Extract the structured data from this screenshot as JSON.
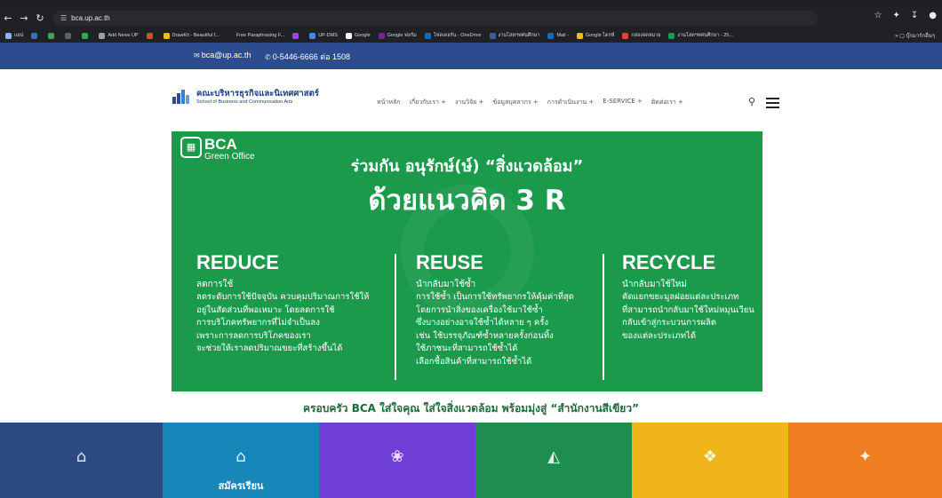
{
  "browser": {
    "url": "bca.up.ac.th",
    "bookmarks": [
      {
        "label": "แอป",
        "color": "#8ab4f8"
      },
      {
        "label": "",
        "color": "#1a73e8"
      },
      {
        "label": "",
        "color": "#34a853"
      },
      {
        "label": "",
        "color": "#5f6368"
      },
      {
        "label": "",
        "color": "#34a853"
      },
      {
        "label": "Add News UP",
        "color": "#9aa0a6"
      },
      {
        "label": "",
        "color": "#ea4335"
      },
      {
        "label": "DrawKit - Beautiful f...",
        "color": "#fbbc04"
      },
      {
        "label": "Free Paraphrasing F...",
        "color": "#202124"
      },
      {
        "label": "",
        "color": "#a142f4"
      },
      {
        "label": "UP-DMS",
        "color": "#4285f4"
      },
      {
        "label": "Google",
        "color": "#ffffff"
      },
      {
        "label": "Google ฟอร์ม",
        "color": "#7b1fa2"
      },
      {
        "label": "โฟลเดอร์น - OneDrive",
        "color": "#0f6cbd"
      },
      {
        "label": "งานโสตฯทศนศึกษา",
        "color": "#3b5ba9"
      },
      {
        "label": "Mail -",
        "color": "#0f6cbd"
      },
      {
        "label": "Google ไดรฟ์",
        "color": "#fbbc04"
      },
      {
        "label": "กล่องจดหมาย",
        "color": "#ea4335"
      },
      {
        "label": "งานโสตฯทศนศึกษา - 25...",
        "color": "#0f9d58"
      }
    ],
    "bookmarks_right": "บุ๊กมาร์กอื่นๆ"
  },
  "contact": {
    "email": "bca@up.ac.th",
    "phone": "0-5446-6666 ต่อ 1508"
  },
  "header": {
    "logo_title": "คณะบริหารธุรกิจและนิเทศศาสตร์",
    "logo_subtitle": "School of Business and Communication Arts",
    "nav": [
      "หน้าหลัก",
      "เกี่ยวกับเรา +",
      "งานวิจัย +",
      "ข้อมูลบุคลากร +",
      "การดำเนินงาน +",
      "E-SERVICE +",
      "ติดต่อเรา +"
    ]
  },
  "banner": {
    "brand": "BCA",
    "brand_sub": "Green Office",
    "headline1": "ร่วมกัน อนุรักษ์(ษ์) “สิ่งแวดล้อม”",
    "headline2": "ด้วยแนวคิด 3 R",
    "reduce": {
      "title": "REDUCE",
      "subtitle": "ลดการใช้",
      "body": "ลดระดับการใช้ปัจจุบัน ควบคุมปริมาณการใช้ให้\nอยู่ในสัดส่วนที่พอเหมาะ โดยลดการใช้\nการบริโภคทรัพยากรที่ไม่จำเป็นลง\nเพราะการลดการบริโภคของเรา\nจะช่วยให้เราลดปริมาณขยะที่สร้างขึ้นได้"
    },
    "reuse": {
      "title": "REUSE",
      "subtitle": "นำกลับมาใช้ซ้ำ",
      "body": "การใช้ซ้ำ เป็นการใช้ทรัพยากรให้คุ้มค่าที่สุด\nโดยการนำสิ่งของเครื่องใช้มาใช้ซ้ำ\nซึ่งบางอย่างอาจใช้ซ้ำได้หลาย ๆ ครั้ง\nเช่น ใช้บรรจุภัณฑ์ซ้ำหลายครั้งก่อนทิ้ง\nใช้ภาชนะที่สามารถใช้ซ้ำได้\nเลือกซื้อสินค้าที่สามารถใช้ซ้ำได้"
    },
    "recycle": {
      "title": "RECYCLE",
      "subtitle": "นำกลับมาใช้ใหม่",
      "body": "คัดแยกขยะมูลฝอยแต่ละประเภท\nที่สามารถนำกลับมาใช้ใหม่หมุนเวียน\nกลับเข้าสู่กระบวนการผลิต\nของแต่ละประเภทได้"
    },
    "colors": {
      "green": "#1b9a4c"
    }
  },
  "tagline": "ครอบครัว BCA ใส่ใจคุณ ใส่ใจสิ่งแวดล้อม พร้อมมุ่งสู่ “สำนักงานสีเขียว”",
  "tiles": [
    {
      "icon": "building-icon",
      "label": "",
      "color": "#2e4a82"
    },
    {
      "icon": "graduation-cap-icon",
      "label": "สมัครเรียน",
      "color": "#1687b8"
    },
    {
      "icon": "globe-people-icon",
      "label": "",
      "color": "#6f3fd8"
    },
    {
      "icon": "360-view-icon",
      "label": "",
      "color": "#1f8d4e"
    },
    {
      "icon": "certificate-icon",
      "label": "",
      "color": "#f1b51c"
    },
    {
      "icon": "book-icon",
      "label": "",
      "color": "#ef7d22"
    }
  ]
}
